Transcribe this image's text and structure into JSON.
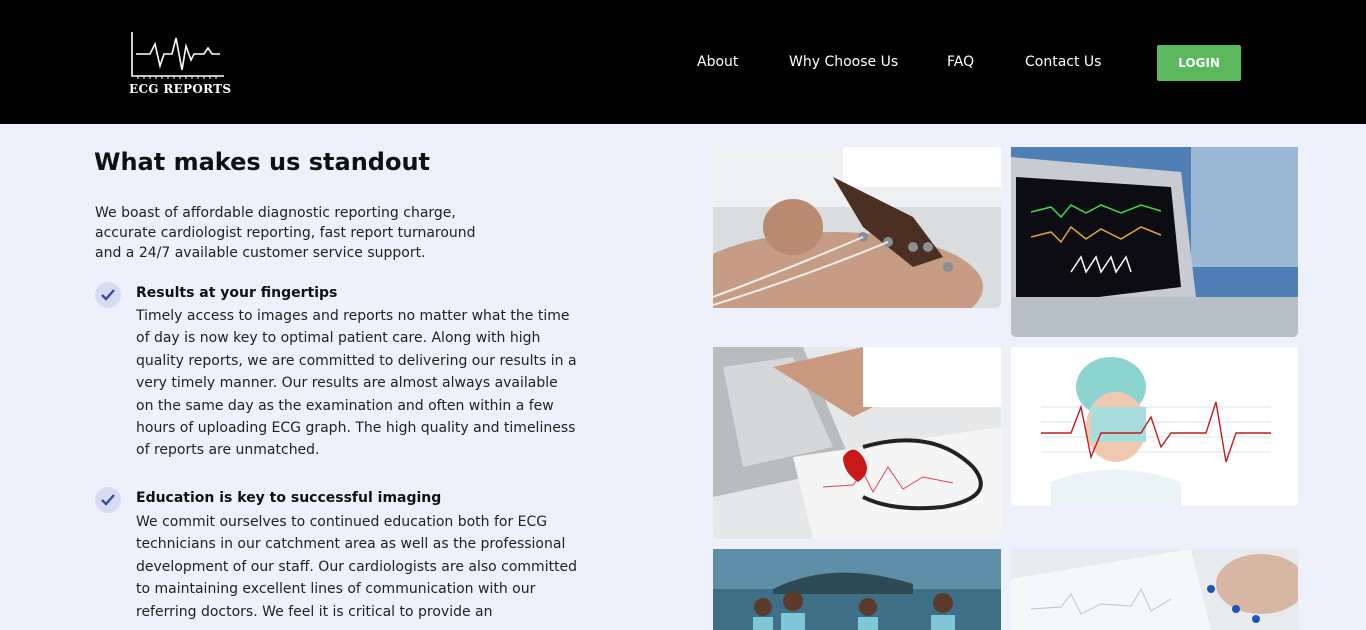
{
  "header": {
    "logo_text": "ECG REPORTS",
    "nav": [
      "About",
      "Why Choose Us",
      "FAQ",
      "Contact Us"
    ],
    "login_label": "LOGIN"
  },
  "main": {
    "title": "What makes us standout",
    "intro_lines": [
      "We boast of affordable diagnostic reporting charge,",
      "accurate cardiologist reporting, fast report turnaround",
      "and a 24/7 available customer service support."
    ],
    "features": [
      {
        "title": "Results at your fingertips",
        "body": "Timely access to images and reports no matter what the time of day is now key to optimal patient care. Along with high quality reports, we are committed to delivering our results in a very timely manner. Our results are almost always available on the same day as the examination and often within a few hours of uploading ECG graph. The high quality and timeliness of reports are unmatched."
      },
      {
        "title": "Education is key to successful imaging",
        "body": "We commit ourselves to continued education both for ECG technicians in our catchment area as well as the professional development of our staff. Our cardiologists are also committed to maintaining excellent lines of communication with our referring doctors. We feel it is critical to provide an"
      }
    ]
  },
  "colors": {
    "header_bg": "#000000",
    "login_bg": "#5cb85c",
    "page_bg": "#eef0fb"
  },
  "icons": [
    "ecg-logo-icon",
    "check-icon"
  ]
}
